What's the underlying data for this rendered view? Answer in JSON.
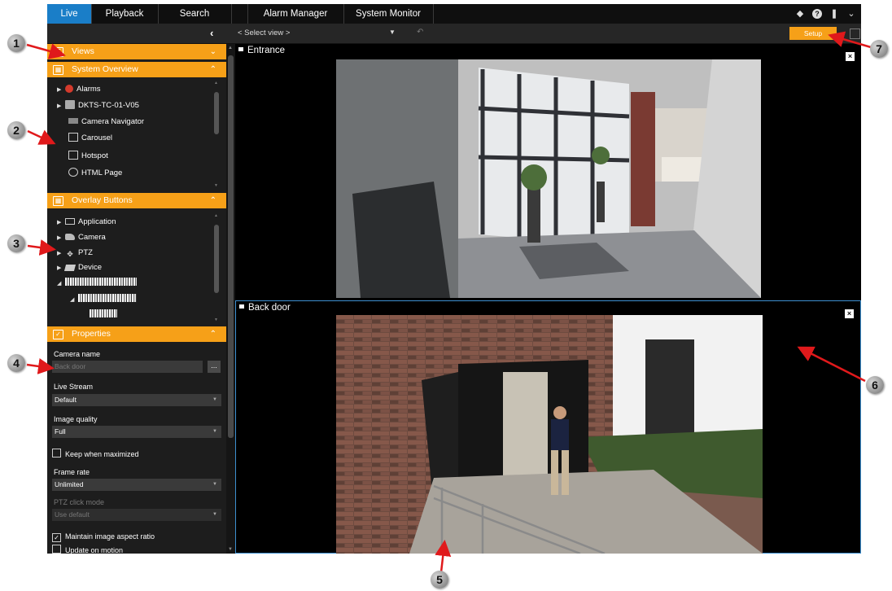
{
  "tabs": [
    {
      "label": "Live",
      "active": true
    },
    {
      "label": "Playback",
      "active": false
    },
    {
      "label": "Search",
      "active": false
    },
    {
      "label": "",
      "active": false
    },
    {
      "label": "Alarm Manager",
      "active": false
    },
    {
      "label": "System Monitor",
      "active": false
    }
  ],
  "top_icons": [
    "status-icon",
    "help-icon",
    "pin-icon",
    "chevron-down-icon"
  ],
  "toolbar": {
    "collapse": "‹",
    "select_view": "< Select view >",
    "setup": "Setup"
  },
  "sidebar": {
    "views_header": "Views",
    "system_overview": {
      "header": "System Overview",
      "items": [
        {
          "label": "Alarms",
          "icon": "alarm-icon",
          "expandable": true
        },
        {
          "label": "DKTS-TC-01-V05",
          "icon": "server-icon",
          "expandable": true
        },
        {
          "label": "Camera Navigator",
          "icon": "camera-navigator-icon",
          "expandable": false
        },
        {
          "label": "Carousel",
          "icon": "carousel-icon",
          "expandable": false
        },
        {
          "label": "Hotspot",
          "icon": "hotspot-icon",
          "expandable": false
        },
        {
          "label": "HTML Page",
          "icon": "globe-icon",
          "expandable": false
        }
      ]
    },
    "overlay_buttons": {
      "header": "Overlay Buttons",
      "items": [
        {
          "label": "Application",
          "icon": "monitor-icon"
        },
        {
          "label": "Camera",
          "icon": "camera-icon"
        },
        {
          "label": "PTZ",
          "icon": "ptz-icon"
        },
        {
          "label": "Device",
          "icon": "device-icon"
        }
      ]
    },
    "properties": {
      "header": "Properties",
      "camera_name_label": "Camera name",
      "camera_name_value": "Back door",
      "dots": "...",
      "live_stream_label": "Live Stream",
      "live_stream_value": "Default",
      "image_quality_label": "Image quality",
      "image_quality_value": "Full",
      "keep_maximized_label": "Keep when maximized",
      "frame_rate_label": "Frame rate",
      "frame_rate_value": "Unlimited",
      "ptz_click_label": "PTZ click mode",
      "ptz_click_value": "Use default",
      "maintain_aspect_label": "Maintain image aspect ratio",
      "update_motion_label": "Update on motion"
    }
  },
  "panes": [
    {
      "title": "Entrance"
    },
    {
      "title": "Back door"
    }
  ],
  "callouts": [
    "1",
    "2",
    "3",
    "4",
    "5",
    "6",
    "7"
  ],
  "colors": {
    "accent_orange": "#f6a018",
    "active_tab_blue": "#1a7ec8",
    "selected_pane_border": "#3d8fd0",
    "callout_arrow_red": "#e0191b"
  }
}
